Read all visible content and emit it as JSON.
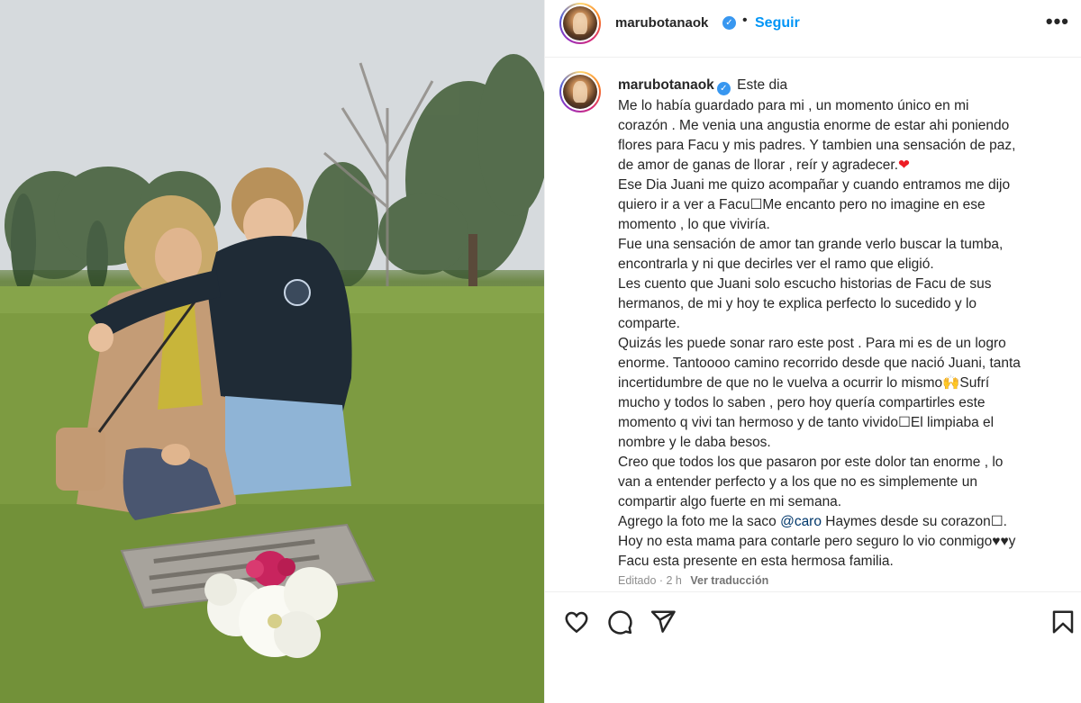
{
  "post": {
    "username": "marubotanaok",
    "follow_label": "Seguir",
    "more_label": "•••",
    "verified_mark": "✓",
    "separator": "•"
  },
  "caption": {
    "first_line": "Este dia",
    "body": "Me lo había guardado para mi , un momento único en mi\ncorazón . Me venia una angustia enorme de estar ahi poniendo\nflores para Facu y mis padres. Y tambien una sensación de paz,\nde amor de ganas de llorar , reír y agradecer.",
    "heart": "❤",
    "body2": "\nEse Dia Juani me quizo acompañar y cuando entramos me dijo\nquiero ir a ver a Facu☐Me encanto pero no imagine en ese\nmomento , lo que viviría.\nFue una sensación de amor tan grande verlo buscar la tumba,\nencontrarla y ni que decirles ver el ramo que eligió.\nLes cuento que Juani solo escucho historias de Facu de sus\nhermanos, de mi y hoy te explica perfecto lo sucedido y lo\ncomparte.\nQuizás les puede sonar raro este post . Para mi es de un logro\nenorme. Tantoooo camino recorrido desde que nació Juani, tanta\nincertidumbre de que no le vuelva a ocurrir lo mismo🙌Sufrí\nmucho y todos lo saben , pero hoy quería compartirles este\nmomento q vivi tan hermoso y de tanto vivido☐El limpiaba el\nnombre y le daba besos.\nCreo que todos los que pasaron por este dolor tan enorme , lo\nvan a entender perfecto y a los que no es simplemente un\ncompartir algo fuerte en mi semana.\nAgrego la foto me la saco ",
    "mention": "@caro",
    "body3": " Haymes desde su corazon☐.\nHoy no esta mama para contarle pero seguro lo vio conmigo♥♥y\nFacu esta presente en esta hermosa familia.",
    "edited": "Editado · 2 h",
    "translate": "Ver traducción"
  },
  "actions": {
    "like": "heart-icon",
    "comment": "comment-icon",
    "share": "share-icon",
    "save": "bookmark-icon"
  },
  "colors": {
    "accent": "#0095f6",
    "verified": "#3897f0",
    "text": "#262626",
    "muted": "#8e8e8e",
    "heart": "#ed1c24"
  }
}
